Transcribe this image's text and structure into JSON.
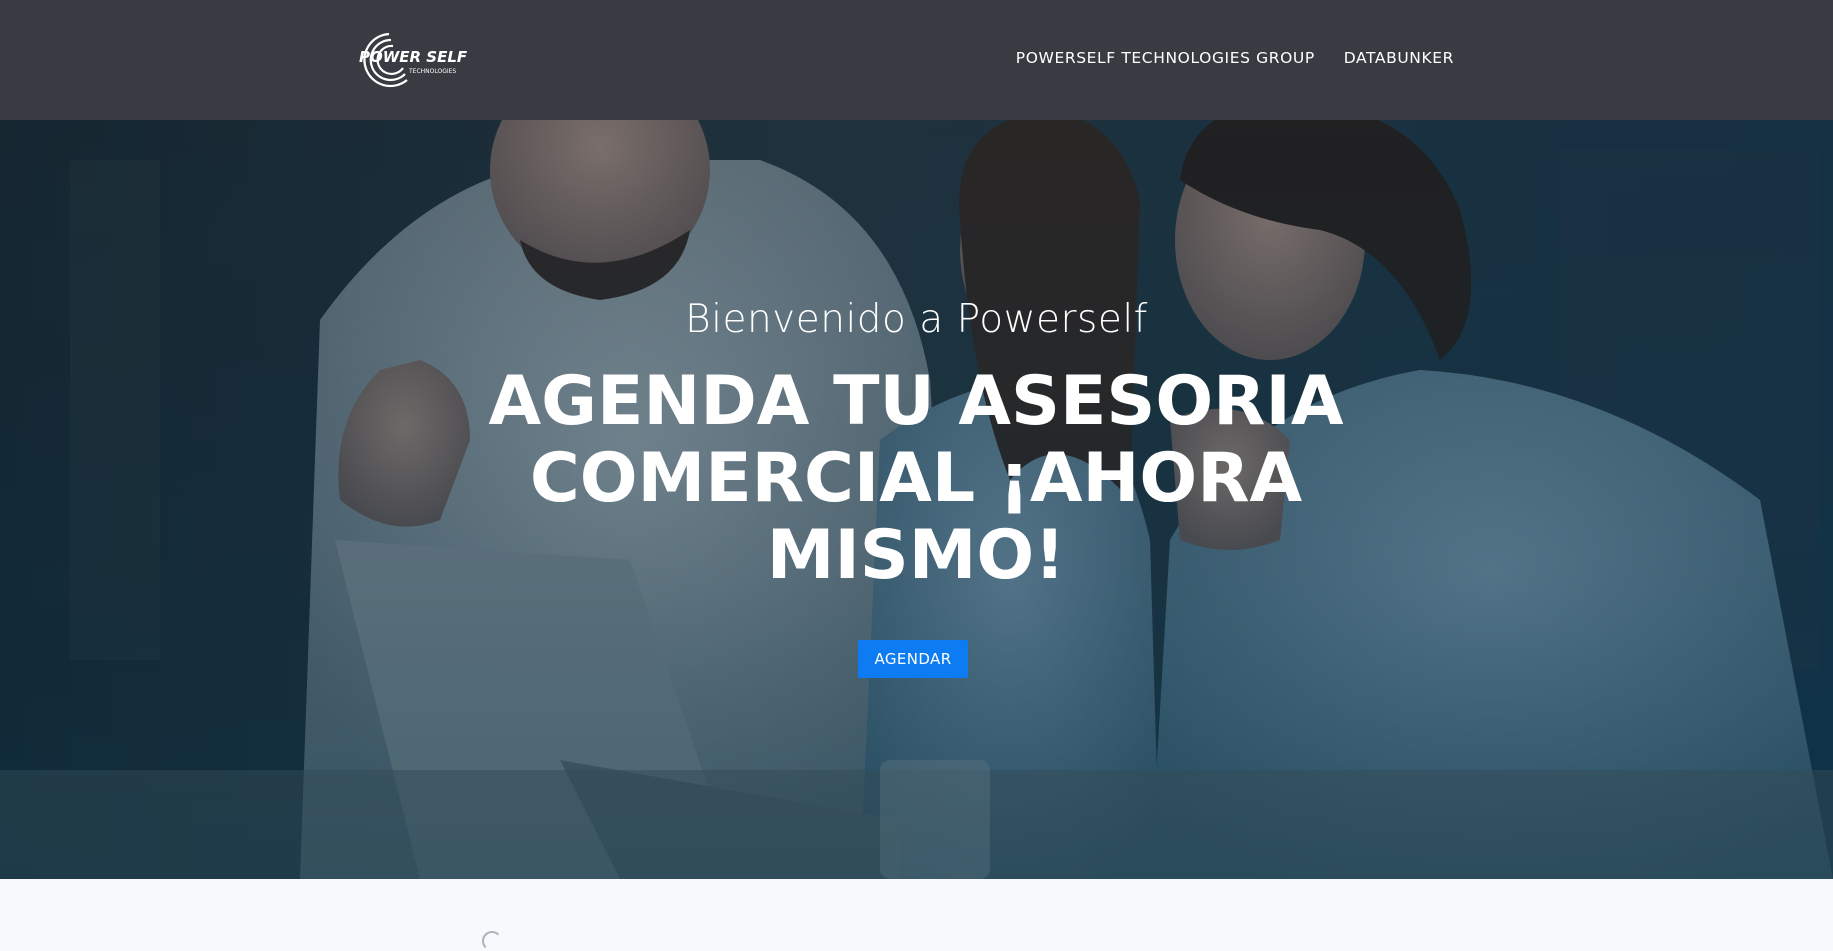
{
  "header": {
    "logo": {
      "text": "POWER SELF",
      "subtext": "TECHNOLOGIES",
      "icon": "swirl-logo-icon"
    },
    "nav": [
      {
        "label": "POWERSELF TECHNOLOGIES GROUP"
      },
      {
        "label": "DATABUNKER"
      }
    ]
  },
  "hero": {
    "subtitle": "Bienvenido a Powerself",
    "title": "AGENDA TU ASESORIA COMERCIAL ¡AHORA MISMO!",
    "cta_label": "AGENDAR",
    "background": "photo-people-at-laptop"
  },
  "colors": {
    "header_bg": "#383b41",
    "cta_bg": "#0d7bf2",
    "hero_tint": "#0a3a52",
    "page_bg": "#f7f9fc"
  }
}
